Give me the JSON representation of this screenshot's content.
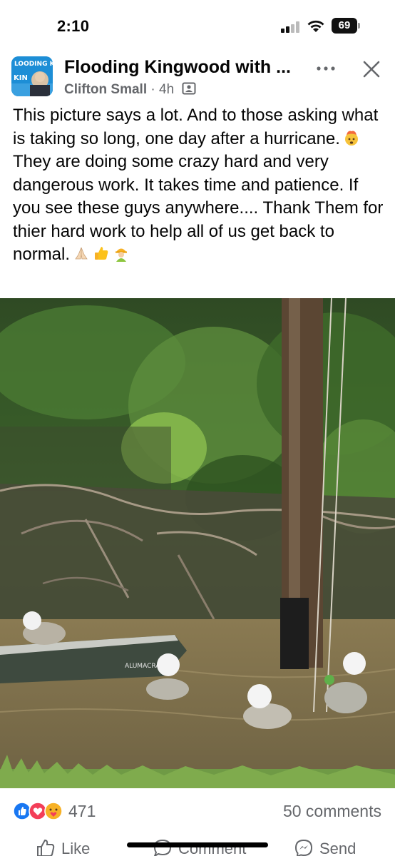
{
  "status_bar": {
    "time": "2:10",
    "battery": "69"
  },
  "post": {
    "group_name": "Flooding Kingwood with ...",
    "author": "Clifton Small",
    "separator": "·",
    "age": "4h",
    "avatar_label": "LOODING K KIN",
    "text_lines": [
      "This picture says a lot. And to those asking what is taking so long, one day after a hurricane.",
      "They are doing some crazy hard and very dangerous work. It takes time and patience. If you see these guys anywhere.... Thank Them for thier hard work to help all of us get back to normal."
    ],
    "photo": {
      "boat_text": "ALUMACRAFT"
    }
  },
  "engagement": {
    "reaction_count": "471",
    "comments": "50 comments",
    "reaction_icons": [
      "like-icon",
      "love-icon",
      "care-icon"
    ]
  },
  "actions": {
    "like": "Like",
    "comment": "Comment",
    "send": "Send"
  },
  "colors": {
    "text": "#050505",
    "secondary": "#65676b",
    "like_blue": "#1877f2",
    "love_red": "#f33e58",
    "care_yellow": "#f7b125"
  }
}
